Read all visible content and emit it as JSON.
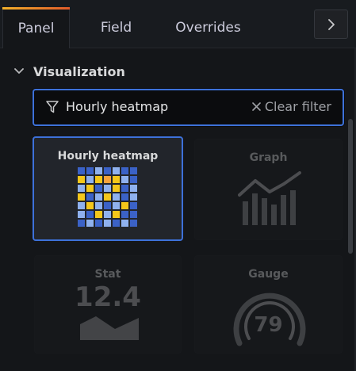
{
  "tabs": [
    {
      "label": "Panel",
      "active": true
    },
    {
      "label": "Field",
      "active": false
    },
    {
      "label": "Overrides",
      "active": false
    }
  ],
  "section": {
    "title": "Visualization",
    "expanded": true
  },
  "search": {
    "value": "Hourly heatmap",
    "clear_label": "Clear filter"
  },
  "visualizations": [
    {
      "name": "Hourly heatmap",
      "selected": true,
      "icon": "heatmap-icon"
    },
    {
      "name": "Graph",
      "selected": false,
      "icon": "graph-icon"
    },
    {
      "name": "Stat",
      "selected": false,
      "icon": "stat-icon",
      "preview_value": "12.4"
    },
    {
      "name": "Gauge",
      "selected": false,
      "icon": "gauge-icon",
      "preview_value": "79"
    }
  ],
  "colors": {
    "accent": "#3d71d9",
    "heat_yellow": "#f5c71a",
    "heat_orange": "#f7a33a",
    "heat_light": "#8fb1ee",
    "heat_dark": "#3b62c7"
  }
}
